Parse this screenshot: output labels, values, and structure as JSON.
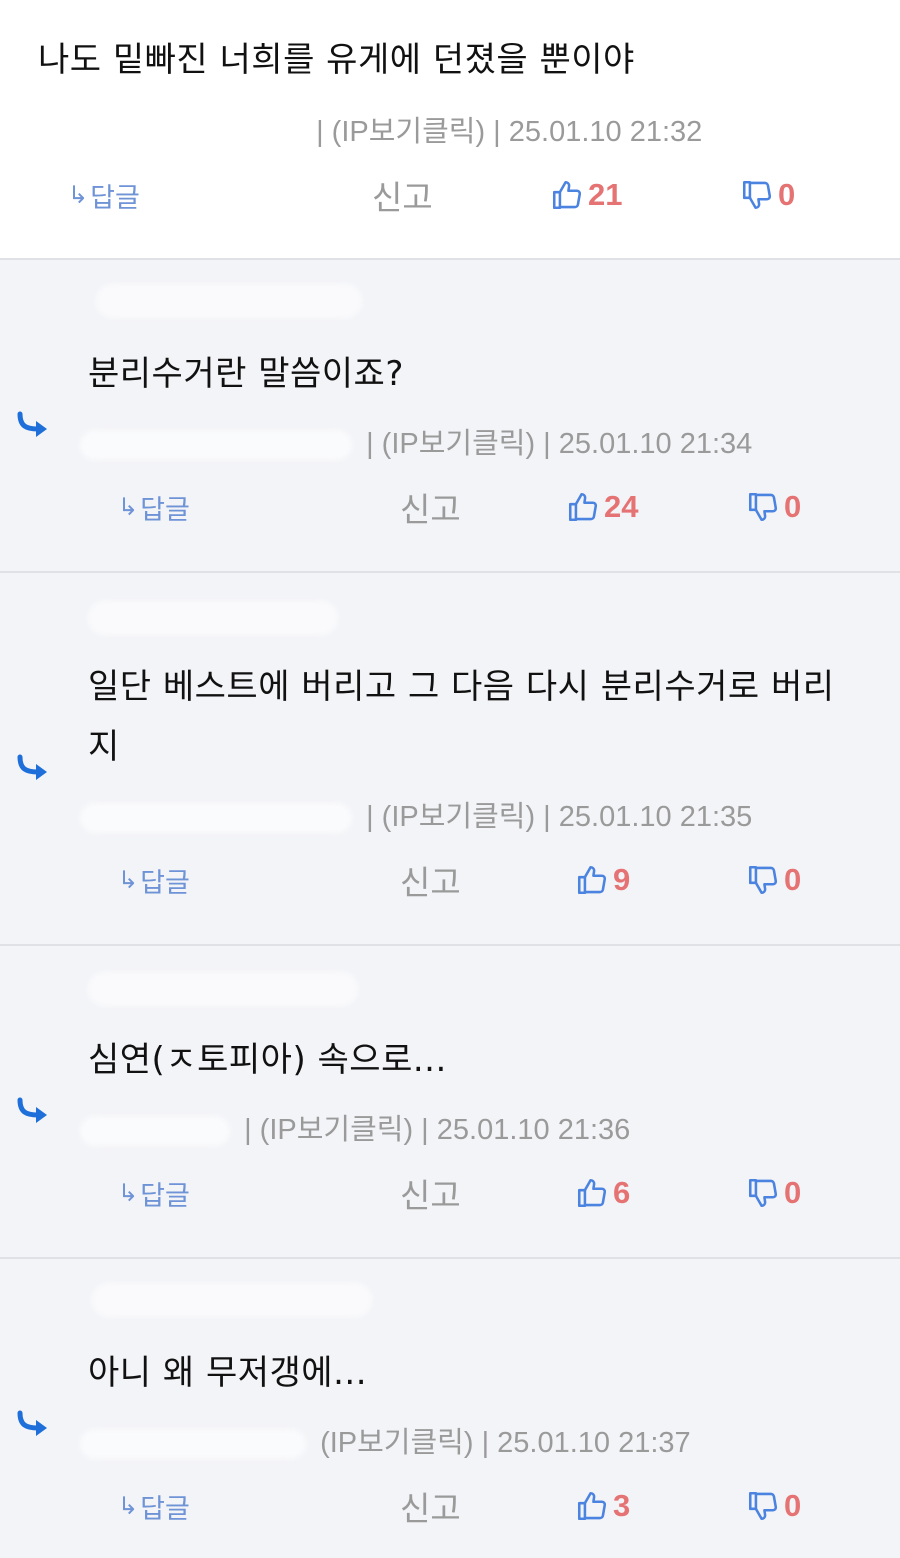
{
  "meta_common": {
    "ip_label": "(IP보기클릭)",
    "separator": "|"
  },
  "actions_common": {
    "reply_arrow": "↳",
    "reply_label": "답글",
    "report_label": "신고"
  },
  "icons": {
    "like": "thumbs-up-icon",
    "dislike": "thumbs-down-icon",
    "reply_marker": "reply-arrow-icon"
  },
  "colors": {
    "reply_link": "#6e93d6",
    "count": "#e57373",
    "meta": "#9a9a9a",
    "reply_arrow": "#1e6fd9",
    "reply_bg": "#f3f4f7"
  },
  "comments": [
    {
      "text": "나도 밑빠진 너희를 유게에 던졌을 뿐이야",
      "timestamp": "25.01.10 21:32",
      "likes": "21",
      "dislikes": "0"
    },
    {
      "text": "분리수거란 말씀이죠?",
      "timestamp": "25.01.10 21:34",
      "likes": "24",
      "dislikes": "0"
    },
    {
      "text": "일단 베스트에 버리고 그 다음 다시 분리수거로 버리지",
      "timestamp": "25.01.10 21:35",
      "likes": "9",
      "dislikes": "0"
    },
    {
      "text": "심연(ㅈ토피아) 속으로...",
      "timestamp": "25.01.10 21:36",
      "likes": "6",
      "dislikes": "0"
    },
    {
      "text": "아니 왜 무저갱에...",
      "timestamp": "25.01.10 21:37",
      "likes": "3",
      "dislikes": "0"
    }
  ]
}
